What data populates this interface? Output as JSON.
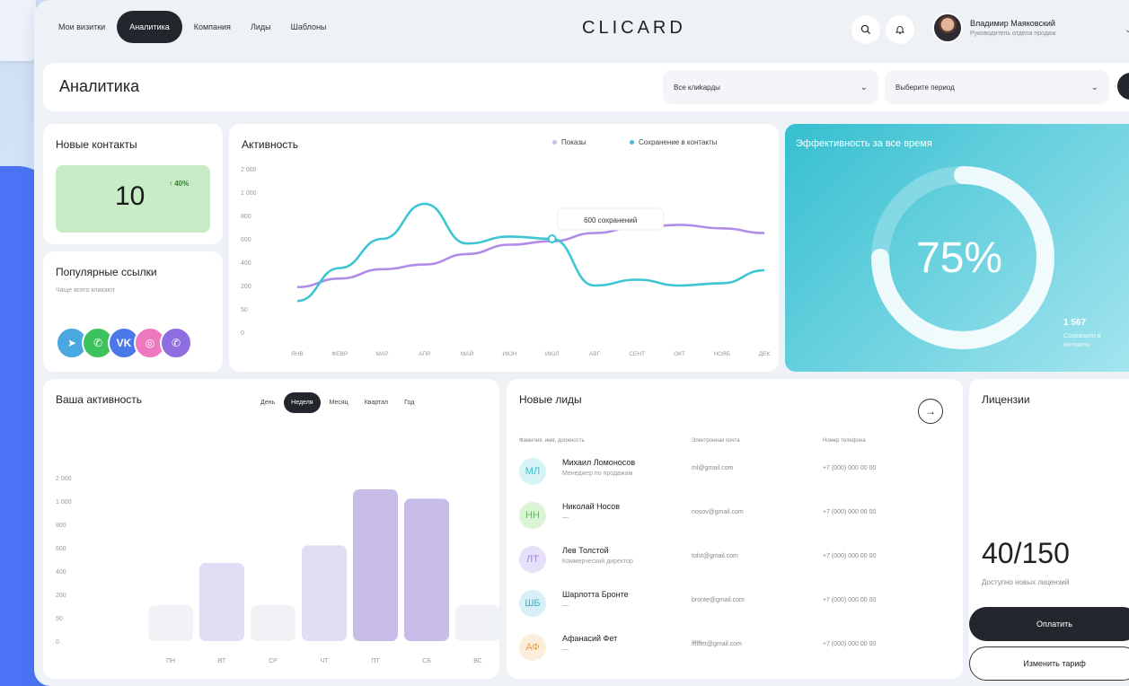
{
  "nav": {
    "items": [
      {
        "label": "Мои визитки",
        "active": false
      },
      {
        "label": "Аналитика",
        "active": true
      },
      {
        "label": "Компания",
        "active": false
      },
      {
        "label": "Лиды",
        "active": false
      },
      {
        "label": "Шаблоны",
        "active": false
      }
    ],
    "brand": "CLICARD",
    "user": {
      "name": "Владимир Маяковский",
      "role": "Руководитель отдела продаж"
    }
  },
  "titlebar": {
    "title": "Аналитика",
    "select_clicards": "Все клиkарды",
    "select_period": "Выберите период"
  },
  "new_contacts": {
    "title": "Новые контакты",
    "value": "10",
    "growth": "↑ 40%"
  },
  "popular_links": {
    "title": "Популярные ссылки",
    "subtitle": "Чаще всего кликают",
    "icons": [
      {
        "name": "telegram-icon",
        "glyph": "➤",
        "color": "#4aa8e0"
      },
      {
        "name": "whatsapp-icon",
        "glyph": "✆",
        "color": "#3cc35d"
      },
      {
        "name": "vk-icon",
        "glyph": "VK",
        "color": "#4a78e8"
      },
      {
        "name": "instagram-icon",
        "glyph": "◎",
        "color": "#ef79c0"
      },
      {
        "name": "viber-icon",
        "glyph": "✆",
        "color": "#8f6fe0"
      }
    ]
  },
  "chart_data": [
    {
      "type": "line",
      "title": "Активность",
      "legend": [
        "Показы",
        "Сохранение в контакты"
      ],
      "x": [
        "ЯНВ",
        "ФЕВР",
        "МАР",
        "АПР",
        "МАЙ",
        "ИЮН",
        "ИЮЛ",
        "АВГ",
        "СЕНТ",
        "ОКТ",
        "НОЯБ",
        "ДЕК"
      ],
      "y_ticks": [
        "2 000",
        "1 000",
        "800",
        "600",
        "400",
        "200",
        "50",
        "0"
      ],
      "series": [
        {
          "name": "Показы",
          "color": "#b08be8",
          "values": [
            190,
            260,
            340,
            380,
            470,
            550,
            580,
            650,
            700,
            720,
            690,
            650
          ]
        },
        {
          "name": "Сохранение в контакты",
          "color": "#3cc6d4",
          "values": [
            100,
            350,
            600,
            900,
            560,
            620,
            600,
            200,
            250,
            200,
            220,
            330
          ]
        }
      ],
      "annotation": "600 сохранений"
    },
    {
      "type": "bar",
      "title": "Ваша активность",
      "categories": [
        "ПН",
        "ВТ",
        "СР",
        "ЧТ",
        "ПТ",
        "СБ",
        "ВС"
      ],
      "values": [
        40,
        470,
        70,
        620,
        1500,
        1100,
        60
      ],
      "y_ticks": [
        "2 000",
        "1 000",
        "800",
        "600",
        "400",
        "200",
        "50",
        "0"
      ],
      "colors": [
        "#f0f2f6",
        "#e2dcf5",
        "#f0f2f6",
        "#e2dcf5",
        "#c8bde8",
        "#c8bde8",
        "#f0f2f6"
      ],
      "tabs": [
        "День",
        "Неделя",
        "Месяц",
        "Квартал",
        "Год"
      ],
      "active_tab": "Неделя"
    }
  ],
  "efficiency": {
    "title": "Эффективность за все время",
    "percent": "75%",
    "percent_value": 0.75,
    "saved": "1 567",
    "saved_label": "Сохранили в контакты"
  },
  "leads": {
    "title": "Новые лиды",
    "headers": {
      "name": "Фамилия, имя, должность",
      "email": "Электронная почта",
      "phone": "Номер телефона"
    },
    "rows": [
      {
        "initials": "МЛ",
        "name": "Михаил Ломоносов",
        "role": "Менеджер по продажам",
        "email": "ml@gmail.com",
        "phone": "+7 (000) 000 00 00",
        "bg": "#d6f4f6",
        "fg": "#3cbcc8"
      },
      {
        "initials": "НН",
        "name": "Николай Носов",
        "role": "—",
        "email": "nosov@gmail.com",
        "phone": "+7 (000) 000 00 00",
        "bg": "#dcf4d6",
        "fg": "#5cc05c"
      },
      {
        "initials": "ЛТ",
        "name": "Лев Толстой",
        "role": "Коммерческий директор",
        "email": "tolst@gmail.com",
        "phone": "+7 (000) 000 00 00",
        "bg": "#e6e0f8",
        "fg": "#9c86e0"
      },
      {
        "initials": "ШБ",
        "name": "Шарлотта Бронте",
        "role": "—",
        "email": "bronte@gmail.com",
        "phone": "+7 (000) 000 00 00",
        "bg": "#d6f0f6",
        "fg": "#3cb4cc"
      },
      {
        "initials": "АФ",
        "name": "Афанасий Фет",
        "role": "—",
        "email": "ffffffet@gmail.com",
        "phone": "+7 (000) 000 00 00",
        "bg": "#fbeedb",
        "fg": "#e4a24a"
      }
    ]
  },
  "licenses": {
    "title": "Лицензии",
    "value": "40/150",
    "subtitle": "Доступно новых лицензий",
    "pay": "Оплатить",
    "change_tariff": "Изменить тариф"
  }
}
